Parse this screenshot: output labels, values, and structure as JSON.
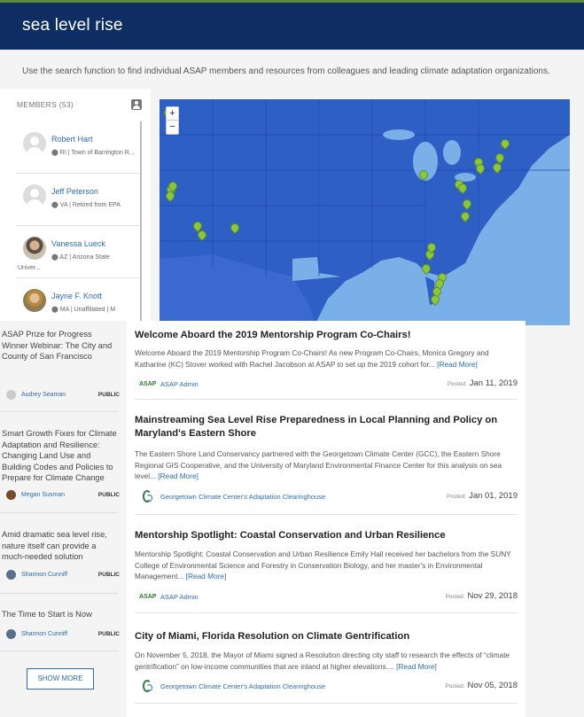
{
  "header": {
    "title": "sea level rise"
  },
  "intro": "Use the search function to find individual ASAP members and resources from colleagues and leading climate adaptation organizations.",
  "members": {
    "heading": "MEMBERS (53)",
    "items": [
      {
        "name": "Robert Hart",
        "detail": "RI | Town of Barrington R...",
        "detail2": ""
      },
      {
        "name": "Jeff Peterson",
        "detail": "VA | Retired from EPA",
        "detail2": ""
      },
      {
        "name": "Vanessa Lueck",
        "detail": "AZ | Arizona State",
        "detail2": "Univer..."
      },
      {
        "name": "Jayne F. Knott",
        "detail": "MA | Unaffiliated | M",
        "detail2": ""
      }
    ]
  },
  "map": {
    "zoom_in": "+",
    "zoom_out": "−",
    "pin_color": "#8cc63f",
    "land_color": "#2d5fc4",
    "water_color": "#7ab0e8"
  },
  "resources": [
    {
      "title": "ASAP Prize for Progress Winner Webinar: The City and County of San Francisco",
      "author": "Audrey Seaman",
      "visibility": "PUBLIC"
    },
    {
      "title": "Smart Growth Fixes for Climate Adaptation and Resilience: Changing Land Use and Building Codes and Policies to Prepare for Climate Change",
      "author": "Megan Susman",
      "visibility": "PUBLIC"
    },
    {
      "title": "Amid dramatic sea level rise, nature itself can provide a much-needed solution",
      "author": "Shannon Cunniff",
      "visibility": "PUBLIC"
    },
    {
      "title": "The Time to Start is Now",
      "author": "Shannon Cunniff",
      "visibility": "PUBLIC"
    }
  ],
  "show_more": "SHOW MORE",
  "articles": [
    {
      "title": "Welcome Aboard the 2019 Mentorship Program Co-Chairs!",
      "body": "Welcome Aboard the 2019 Mentorship Program Co-Chairs! As new Program Co-Chairs, Monica Gregory and Katharine (KC) Stover worked with Rachel Jacobson at ASAP to set up the 2019 cohort for...",
      "read_more": "[Read More]",
      "logo": "ASAP",
      "source": "ASAP Admin",
      "posted_label": "Posted:",
      "date": "Jan 11, 2019"
    },
    {
      "title": "Mainstreaming Sea Level Rise Preparedness in Local Planning and Policy on Maryland's Eastern Shore",
      "body": "The Eastern Shore Land Conservancy partnered with the Georgetown Climate Center (GCC), the Eastern Shore Regional GIS Cooperative, and the University of Maryland Environmental Finance Center for this analysis on sea level...",
      "read_more": "[Read More]",
      "logo": "",
      "source": "Georgetown Climate Center's Adaptation Clearinghouse",
      "posted_label": "Posted:",
      "date": "Jan 01, 2019"
    },
    {
      "title": "Mentorship Spotlight: Coastal Conservation and Urban Resilience",
      "body": "Mentorship Spotlight: Coastal Conservation and Urban Resilience Emily Hall received her bachelors from the SUNY College of Environmental Science and Forestry in Conservation Biology, and her master's in Environmental Management...",
      "read_more": "[Read More]",
      "logo": "ASAP",
      "source": "ASAP Admin",
      "posted_label": "Posted:",
      "date": "Nov 29, 2018"
    },
    {
      "title": "City of Miami, Florida Resolution on Climate Gentrification",
      "body": "On November 5, 2018, the Mayor of Miami signed a Resolution directing city staff to research the effects of “climate gentrification” on low-income communities that are inland at higher elevations....",
      "read_more": "[Read More]",
      "logo": "",
      "source": "Georgetown Climate Center's Adaptation Clearinghouse",
      "posted_label": "Posted:",
      "date": "Nov 05, 2018"
    }
  ]
}
